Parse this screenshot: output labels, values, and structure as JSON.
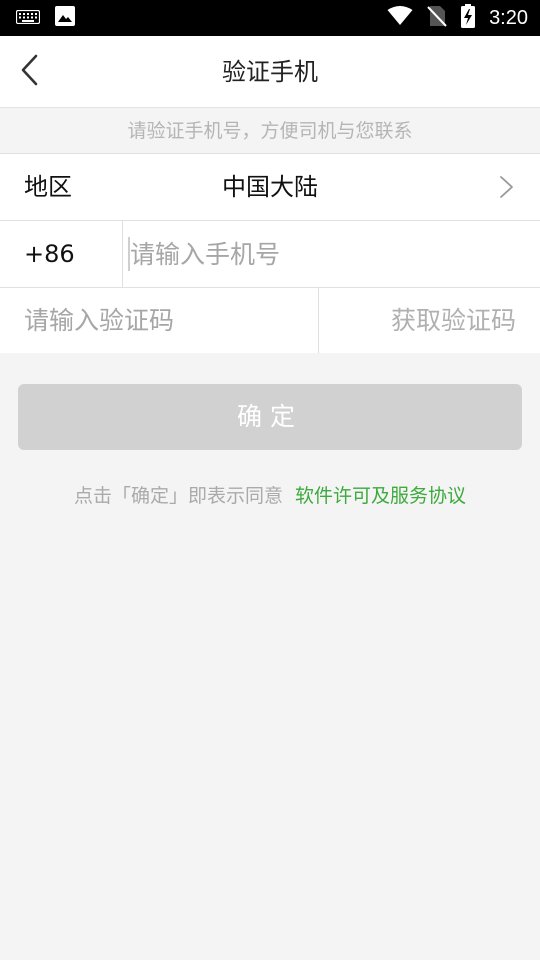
{
  "status_bar": {
    "time": "3:20",
    "icons": [
      "keyboard-icon",
      "image-icon",
      "wifi-icon",
      "no-sim-icon",
      "battery-charging-icon"
    ]
  },
  "nav": {
    "title": "验证手机",
    "back_icon": "chevron-left-icon"
  },
  "hint": "请验证手机号，方便司机与您联系",
  "form": {
    "region_label": "地区",
    "region_value": "中国大陆",
    "country_code": "+86",
    "phone_value": "",
    "phone_placeholder": "请输入手机号",
    "code_value": "",
    "code_placeholder": "请输入验证码",
    "get_code_label": "获取验证码"
  },
  "confirm_label": "确定",
  "agreement": {
    "prefix": "点击「确定」即表示同意",
    "link": "软件许可及服务协议"
  },
  "colors": {
    "link_green": "#3daa3d",
    "disabled_button": "#d1d1d1",
    "background": "#f4f4f4"
  }
}
